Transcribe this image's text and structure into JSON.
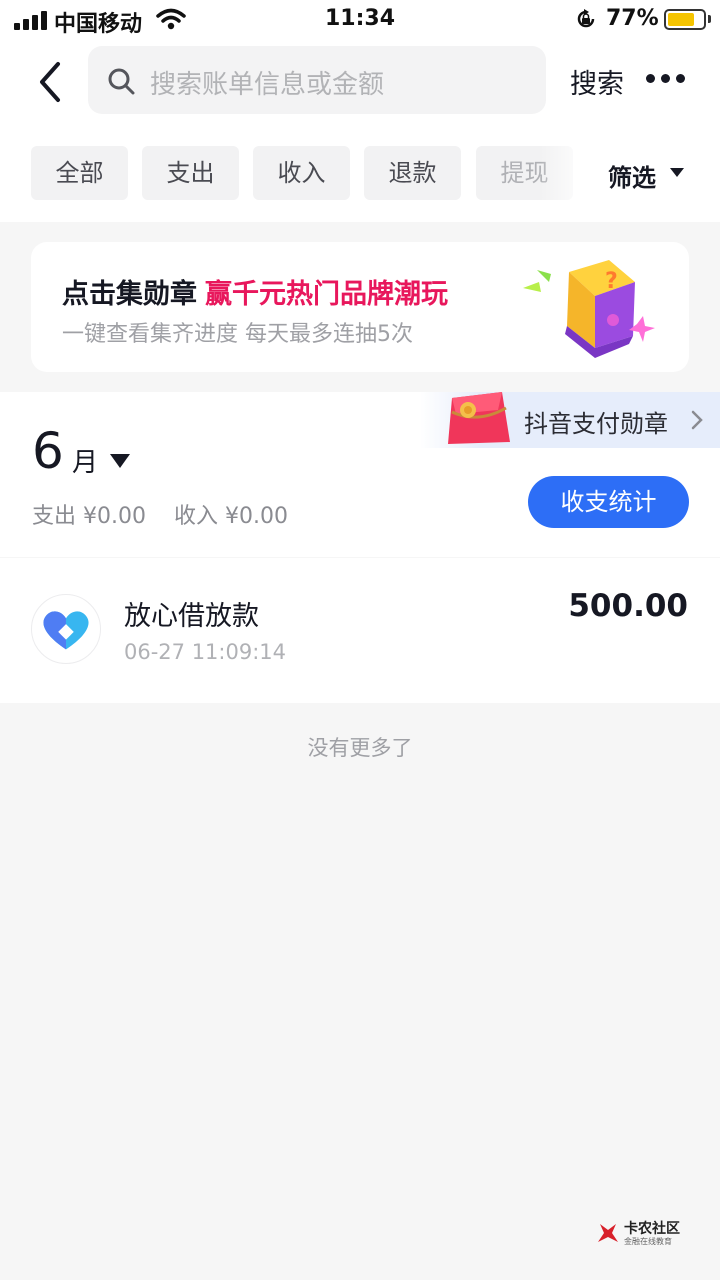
{
  "status_bar": {
    "carrier": "中国移动",
    "time": "11:34",
    "battery_percent": "77%",
    "battery_level": 0.77
  },
  "header": {
    "search_placeholder": "搜索账单信息或金额",
    "search_button": "搜索"
  },
  "filters": {
    "chips": [
      "全部",
      "支出",
      "收入",
      "退款",
      "提现"
    ],
    "filter_label": "筛选"
  },
  "promo": {
    "title_prefix": "点击集勋章",
    "title_highlight": "赢千元热门品牌潮玩",
    "subtitle": "一键查看集齐进度 每天最多连抽5次",
    "highlight_color": "#e8175c"
  },
  "badge": {
    "label": "抖音支付勋章"
  },
  "month": {
    "number": "6",
    "unit": "月",
    "expense": "支出 ¥0.00",
    "income": "收入 ¥0.00",
    "stats_button": "收支统计",
    "accent_color": "#2d6ef6"
  },
  "transactions": [
    {
      "name": "放心借放款",
      "time": "06-27 11:09:14",
      "amount": "500.00",
      "icon": "fangxinjie-logo-icon"
    }
  ],
  "footer": {
    "no_more": "没有更多了",
    "watermark_title": "卡农社区",
    "watermark_sub": "金融在线教育"
  }
}
